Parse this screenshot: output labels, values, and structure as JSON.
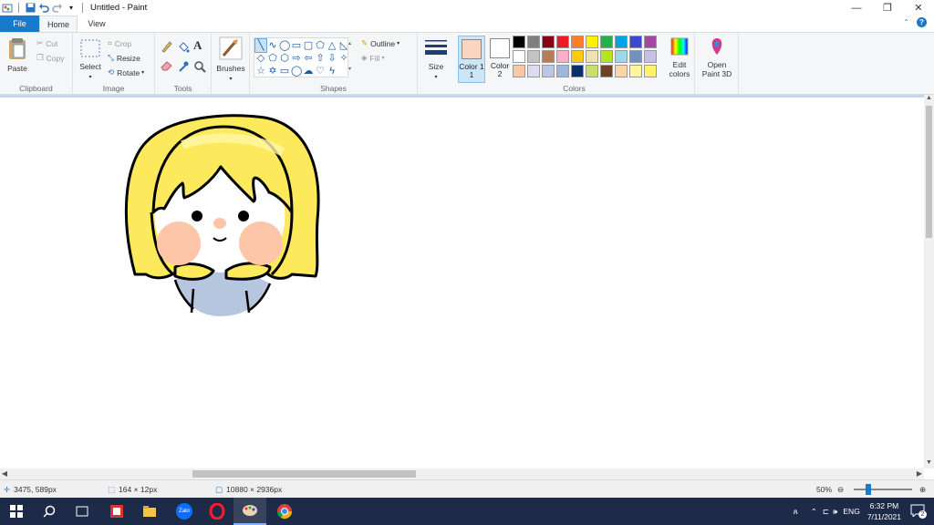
{
  "window": {
    "title": "Untitled - Paint"
  },
  "tabs": [
    {
      "label": "File"
    },
    {
      "label": "Home"
    },
    {
      "label": "View"
    }
  ],
  "clipboard": {
    "paste": "Paste",
    "cut": "Cut",
    "copy": "Copy",
    "group": "Clipboard"
  },
  "image": {
    "select": "Select",
    "crop": "Crop",
    "resize": "Resize",
    "rotate": "Rotate",
    "group": "Image"
  },
  "tools": {
    "group": "Tools"
  },
  "brushes": {
    "label": "Brushes"
  },
  "shapes": {
    "outline": "Outline",
    "fill": "Fill",
    "group": "Shapes"
  },
  "size": {
    "label": "Size"
  },
  "colors": {
    "color1_label": "Color 1",
    "color1_sub": "1",
    "color2_label": "Color",
    "color2_sub": "2",
    "edit_colors": "Edit colors",
    "open_paint3d": "Open Paint 3D",
    "group": "Colors",
    "color1": "#fcd5be",
    "color2": "#ffffff",
    "palette": [
      "#000000",
      "#7f7f7f",
      "#880015",
      "#ed1c24",
      "#ff7f27",
      "#fff200",
      "#22b14c",
      "#00a2e8",
      "#3f48cc",
      "#a349a4",
      "#ffffff",
      "#c3c3c3",
      "#b97a57",
      "#ffaec9",
      "#ffc90e",
      "#efe4b0",
      "#b5e61d",
      "#99d9ea",
      "#7092be",
      "#c8bfe7",
      "#f9c7a8",
      "#dcdcf0",
      "#b9c8e0",
      "#9eb6d8",
      "#0b2e6e",
      "#c8e06a",
      "#6e4224",
      "#f9d6a8",
      "#fff599",
      "#fff26d"
    ]
  },
  "status": {
    "cursor": "3475, 589px",
    "selection": "164 × 12px",
    "canvas_size": "10880 × 2936px",
    "zoom": "50%"
  },
  "taskbar": {
    "lang": "ENG",
    "time": "6:32 PM",
    "date": "7/11/2021",
    "notifications": "2",
    "zalo": "Zalo"
  }
}
